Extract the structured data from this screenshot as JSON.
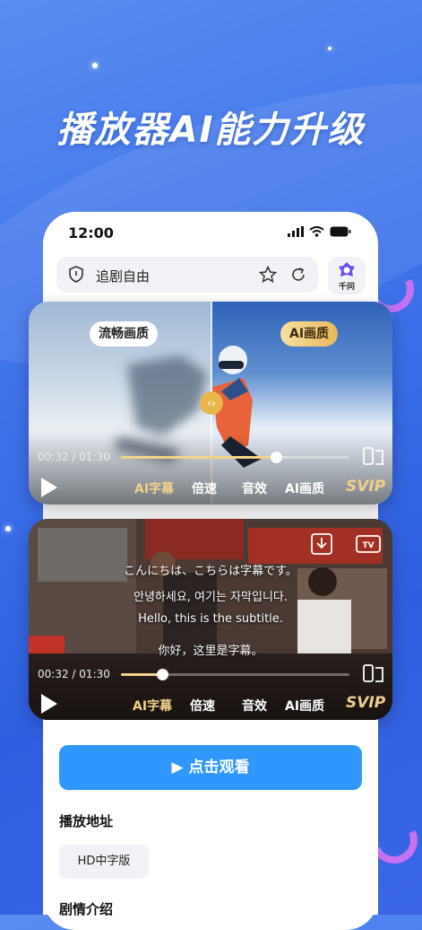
{
  "headline": "播放器AI能力升级",
  "status_bar": {
    "time": "12:00"
  },
  "address_bar": {
    "text": "追剧自由"
  },
  "assistant": {
    "label": "千问"
  },
  "player1": {
    "left_tag": "流畅画质",
    "right_tag": "AI画质",
    "current_time": "00:32",
    "separator": "/",
    "total_time": "01:30",
    "progress": 0.68,
    "menu": [
      "AI字幕",
      "倍速",
      "音效",
      "AI画质"
    ],
    "badge": "SVIP"
  },
  "player2": {
    "subtitles": [
      "こんにちは、こちらは字幕です。",
      "안녕하세요, 여기는 자막입니다.",
      "Hello, this is the subtitle.",
      "你好，这里是字幕。"
    ],
    "current_time": "00:32",
    "separator": "/",
    "total_time": "01:30",
    "progress": 0.18,
    "menu": [
      "AI字幕",
      "倍速",
      "音效",
      "AI画质"
    ],
    "badge": "SVIP"
  },
  "watch_button": {
    "label": "▶ 点击观看"
  },
  "play_address": {
    "title": "播放地址",
    "chip": "HD中字版"
  },
  "synopsis": {
    "title": "剧情介绍"
  },
  "colors": {
    "accent": "#2f97ff",
    "gold": "#f3d28a",
    "background": "#3f74ea"
  }
}
